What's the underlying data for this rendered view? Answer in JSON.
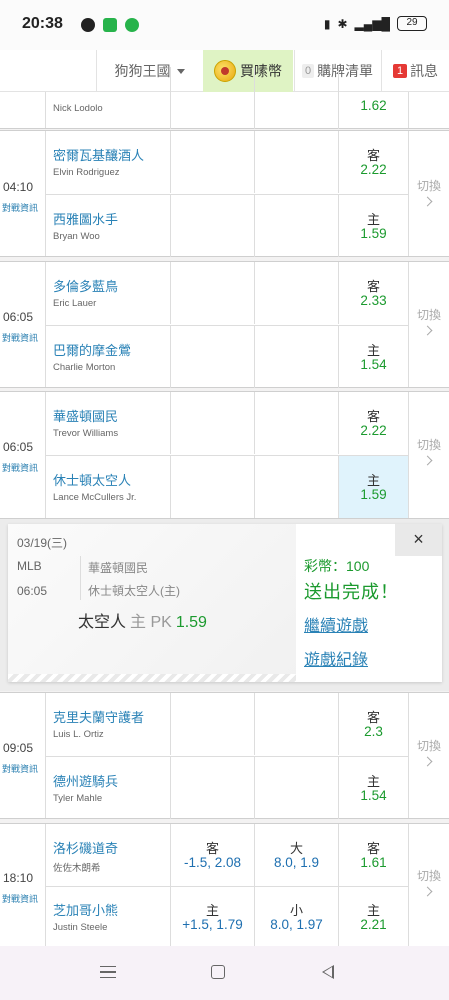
{
  "status_bar": {
    "time": "20:38",
    "battery": "29"
  },
  "nav": {
    "dog_kingdom": "狗狗王國",
    "buy_coins": "買嗉幣",
    "slip_count": "0",
    "slip_label": "購牌清單",
    "msg_count": "1",
    "msg_label": "訊息"
  },
  "top_partial": {
    "pitcher": "Nick Lodolo",
    "odds": "1.62"
  },
  "games": [
    {
      "time": "04:10",
      "info": "對戰資訊",
      "switch": "切換",
      "away": {
        "team": "密爾瓦基釀酒人",
        "pitcher": "Elvin Rodriguez",
        "ml_label": "客",
        "ml_odds": "2.22"
      },
      "home": {
        "team": "西雅圖水手",
        "pitcher": "Bryan Woo",
        "ml_label": "主",
        "ml_odds": "1.59"
      }
    },
    {
      "time": "06:05",
      "info": "對戰資訊",
      "switch": "切換",
      "away": {
        "team": "多倫多藍鳥",
        "pitcher": "Eric Lauer",
        "ml_label": "客",
        "ml_odds": "2.33"
      },
      "home": {
        "team": "巴爾的摩金鶯",
        "pitcher": "Charlie Morton",
        "ml_label": "主",
        "ml_odds": "1.54"
      }
    },
    {
      "time": "06:05",
      "info": "對戰資訊",
      "switch": "切換",
      "away": {
        "team": "華盛頓國民",
        "pitcher": "Trevor Williams",
        "ml_label": "客",
        "ml_odds": "2.22"
      },
      "home": {
        "team": "休士頓太空人",
        "pitcher": "Lance McCullers Jr.",
        "ml_label": "主",
        "ml_odds": "1.59"
      }
    },
    {
      "time": "09:05",
      "info": "對戰資訊",
      "switch": "切換",
      "away": {
        "team": "克里夫蘭守護者",
        "pitcher": "Luis L. Ortiz",
        "ml_label": "客",
        "ml_odds": "2.3"
      },
      "home": {
        "team": "德州遊騎兵",
        "pitcher": "Tyler Mahle",
        "ml_label": "主",
        "ml_odds": "1.54"
      }
    },
    {
      "time": "18:10",
      "info": "對戰資訊",
      "switch": "切換",
      "away": {
        "team": "洛杉磯道奇",
        "pitcher": "佐佐木朗希",
        "spread_label": "客",
        "spread_odds": "-1.5, 2.08",
        "total_label": "大",
        "total_odds": "8.0, 1.9",
        "ml_label": "客",
        "ml_odds": "1.61"
      },
      "home": {
        "team": "芝加哥小熊",
        "pitcher": "Justin Steele",
        "spread_label": "主",
        "spread_odds": "+1.5, 1.79",
        "total_label": "小",
        "total_odds": "8.0, 1.97",
        "ml_label": "主",
        "ml_odds": "2.21"
      }
    }
  ],
  "popup": {
    "date": "03/19(三)",
    "league": "MLB",
    "time": "06:05",
    "team1": "華盛頓國民",
    "team2": "休士頓太空人(主)",
    "bet_team": "太空人",
    "bet_side": "主 PK",
    "bet_odds": "1.59",
    "coins": "彩幣：100",
    "done": "送出完成！",
    "continue": "繼續遊戲",
    "records": "遊戲紀錄",
    "close": "×"
  }
}
